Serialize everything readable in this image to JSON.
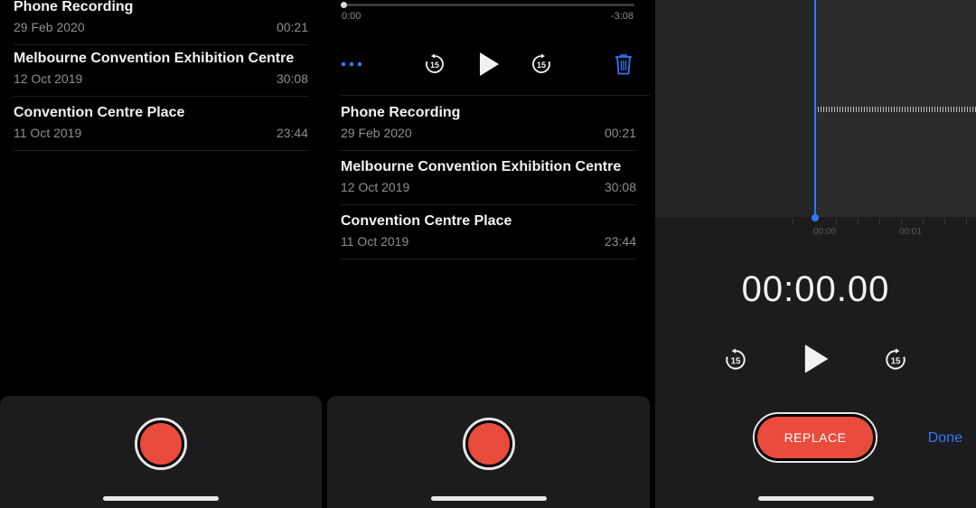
{
  "recordings": [
    {
      "title": "Phone Recording",
      "date": "29 Feb 2020",
      "duration": "00:21"
    },
    {
      "title": "Melbourne Convention Exhibition Centre",
      "date": "12 Oct 2019",
      "duration": "30:08"
    },
    {
      "title": "Convention Centre Place",
      "date": "11 Oct 2019",
      "duration": "23:44"
    }
  ],
  "player": {
    "elapsed": "0:00",
    "remaining": "-3:08",
    "progress_fraction": 0.0
  },
  "editor": {
    "timer": "00:00.00",
    "ruler_labels": [
      "00:00",
      "00:01"
    ],
    "replace_label": "REPLACE",
    "done_label": "Done"
  },
  "icons": {
    "more": "ellipsis-icon",
    "skip_back": "skip-back-15-icon",
    "play": "play-icon",
    "skip_forward": "skip-forward-15-icon",
    "delete": "trash-icon",
    "skip_amount": "15"
  },
  "colors": {
    "record_red": "#e94b3c",
    "accent_blue": "#3478f6",
    "background": "#000000",
    "panel": "#1c1c1e"
  }
}
